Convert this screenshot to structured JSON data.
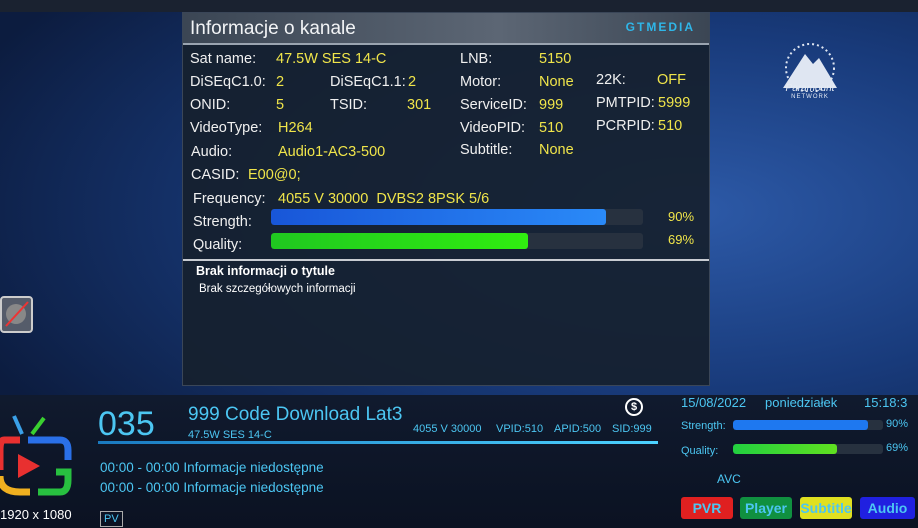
{
  "dialog": {
    "title": "Informacje o kanale",
    "brand": "GTMEDIA",
    "fields": {
      "sat_name": {
        "label": "Sat name:",
        "value": "47.5W SES 14-C"
      },
      "lnb": {
        "label": "LNB:",
        "value": "5150"
      },
      "diseqc10": {
        "label": "DiSEqC1.0:",
        "value": "2"
      },
      "diseqc11": {
        "label": "DiSEqC1.1:",
        "value": "2"
      },
      "motor": {
        "label": "Motor:",
        "value": "None"
      },
      "k22": {
        "label": "22K:",
        "value": "OFF"
      },
      "onid": {
        "label": "ONID:",
        "value": "5"
      },
      "tsid": {
        "label": "TSID:",
        "value": "301"
      },
      "service_id": {
        "label": "ServiceID:",
        "value": "999"
      },
      "pmtpid": {
        "label": "PMTPID:",
        "value": "5999"
      },
      "video_type": {
        "label": "VideoType:",
        "value": "H264"
      },
      "video_pid": {
        "label": "VideoPID:",
        "value": "510"
      },
      "pcrpid": {
        "label": "PCRPID:",
        "value": "510"
      },
      "audio": {
        "label": "Audio:",
        "value": "Audio1-AC3-500"
      },
      "subtitle": {
        "label": "Subtitle:",
        "value": "None"
      },
      "casid": {
        "label": "CASID:",
        "value": "E00@0;"
      },
      "frequency": {
        "label": "Frequency:",
        "value": "4055 V 30000  DVBS2 8PSK 5/6"
      }
    },
    "strength": {
      "label": "Strength:",
      "percent": 90,
      "text": "90%"
    },
    "quality": {
      "label": "Quality:",
      "percent": 69,
      "text": "69%"
    },
    "epg_title": "Brak informacji o tytule",
    "epg_detail": "Brak szczegółowych informacji"
  },
  "channel_logo": "Paramount NETWORK",
  "infobar": {
    "number": "035",
    "name": "999 Code Download Lat3",
    "satellite": "47.5W SES 14-C",
    "tp": "4055 V 30000",
    "vpid": "VPID:510",
    "apid": "APID:500",
    "sid": "SID:999",
    "resolution": "1920 x 1080",
    "pv": "PV",
    "events": [
      "00:00 - 00:00 Informacje niedostępne",
      "00:00 - 00:00 Informacje niedostępne"
    ],
    "date": "15/08/2022",
    "day": "poniedziałek",
    "time": "15:18:3",
    "strength": {
      "label": "Strength:",
      "percent": 90,
      "text": "90%"
    },
    "quality": {
      "label": "Quality:",
      "percent": 69,
      "text": "69%"
    },
    "codec": "AVC",
    "buttons": {
      "pvr": "PVR",
      "player": "Player",
      "subtitle": "Subtitle",
      "audio": "Audio"
    }
  },
  "colors": {
    "accent": "#4cc6f2",
    "value": "#f0e54a",
    "strength": "#1e78f0",
    "quality": "#22e020"
  }
}
